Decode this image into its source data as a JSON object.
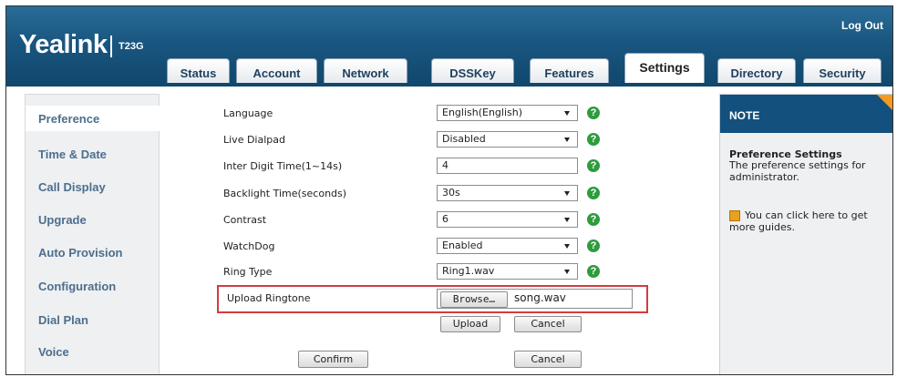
{
  "header": {
    "logo": "Yealink",
    "model": "T23G",
    "logout": "Log Out"
  },
  "tabs": [
    {
      "label": "Status"
    },
    {
      "label": "Account"
    },
    {
      "label": "Network"
    },
    {
      "label": "DSSKey"
    },
    {
      "label": "Features"
    },
    {
      "label": "Settings",
      "active": true
    },
    {
      "label": "Directory"
    },
    {
      "label": "Security"
    }
  ],
  "sidebar": {
    "items": [
      {
        "label": "Preference",
        "active": true
      },
      {
        "label": "Time & Date"
      },
      {
        "label": "Call Display"
      },
      {
        "label": "Upgrade"
      },
      {
        "label": "Auto Provision"
      },
      {
        "label": "Configuration"
      },
      {
        "label": "Dial Plan"
      },
      {
        "label": "Voice"
      }
    ]
  },
  "form": {
    "language": {
      "label": "Language",
      "value": "English(English)"
    },
    "live_dialpad": {
      "label": "Live Dialpad",
      "value": "Disabled"
    },
    "inter_digit": {
      "label": "Inter Digit Time(1~14s)",
      "value": "4"
    },
    "backlight": {
      "label": "Backlight Time(seconds)",
      "value": "30s"
    },
    "contrast": {
      "label": "Contrast",
      "value": "6"
    },
    "watchdog": {
      "label": "WatchDog",
      "value": "Enabled"
    },
    "ring_type": {
      "label": "Ring Type",
      "value": "Ring1.wav"
    },
    "upload_ringtone": {
      "label": "Upload Ringtone",
      "browse": "Browse…",
      "file": "song.wav"
    },
    "upload_button": "Upload",
    "cancel_upload": "Cancel",
    "confirm": "Confirm",
    "cancel": "Cancel",
    "help_glyph": "?"
  },
  "note": {
    "title": "NOTE",
    "subtitle": "Preference Settings",
    "text": "The preference settings for administrator.",
    "guide": "You can click here to get more guides."
  },
  "colors": {
    "header": "#195680",
    "help": "#2f9b3e",
    "highlight": "#d43c3c",
    "note_corner": "#f39a1f"
  }
}
